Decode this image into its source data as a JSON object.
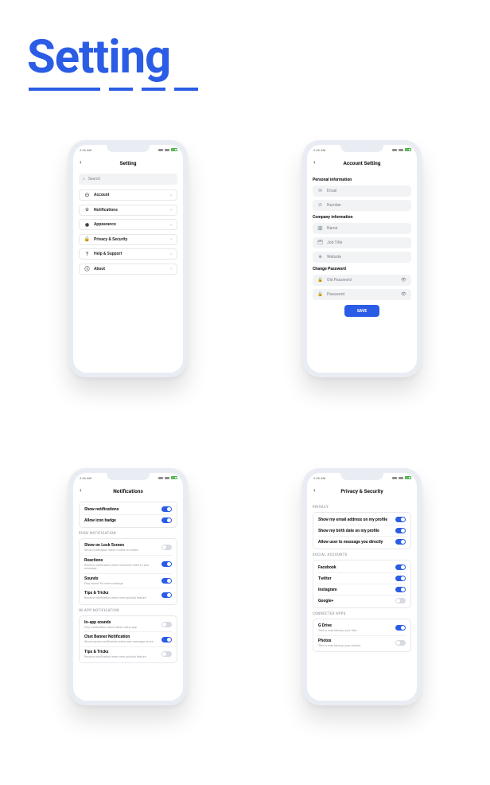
{
  "pageTitle": "Setting",
  "status": {
    "time": "2:36 AM"
  },
  "screen1": {
    "title": "Setting",
    "search": "Search",
    "items": [
      {
        "icon": "account-icon",
        "glyph": "⚇",
        "label": "Account"
      },
      {
        "icon": "notifications-icon",
        "glyph": "☆",
        "label": "Notifications"
      },
      {
        "icon": "appearance-icon",
        "glyph": "◉",
        "label": "Appearance"
      },
      {
        "icon": "privacy-icon",
        "glyph": "🔒",
        "label": "Privacy & Security"
      },
      {
        "icon": "help-icon",
        "glyph": "?",
        "label": "Help & Support"
      },
      {
        "icon": "about-icon",
        "glyph": "ⓘ",
        "label": "About"
      }
    ]
  },
  "screen2": {
    "title": "Account Setting",
    "sections": {
      "personal": {
        "label": "Personal information",
        "fields": [
          {
            "icon": "email-icon",
            "glyph": "✉",
            "placeholder": "Email"
          },
          {
            "icon": "phone-icon",
            "glyph": "✆",
            "placeholder": "Number"
          }
        ]
      },
      "company": {
        "label": "Company information",
        "fields": [
          {
            "icon": "company-icon",
            "glyph": "🏢",
            "placeholder": "Name"
          },
          {
            "icon": "job-icon",
            "glyph": "🗂",
            "placeholder": "Job Title"
          },
          {
            "icon": "website-icon",
            "glyph": "⊕",
            "placeholder": "Website"
          }
        ]
      },
      "password": {
        "label": "Change Password",
        "fields": [
          {
            "icon": "lock-icon",
            "glyph": "🔒",
            "placeholder": "Old Password",
            "eye": true
          },
          {
            "icon": "lock-icon",
            "glyph": "🔒",
            "placeholder": "Password",
            "eye": true
          }
        ]
      }
    },
    "save": "SAVE"
  },
  "screen3": {
    "title": "Notifications",
    "top": [
      {
        "title": "Show notifications",
        "on": true
      },
      {
        "title": "Allow icon badge",
        "on": true
      }
    ],
    "pushLabel": "PUSH NOTIFICATION",
    "push": [
      {
        "title": "Show on Lock Screen",
        "sub": "Show notification when mobile is locked",
        "on": false
      },
      {
        "title": "Reactions",
        "sub": "Receive notification when someone react to your message",
        "on": true
      },
      {
        "title": "Sounds",
        "sub": "Play sound for new message",
        "on": true
      },
      {
        "title": "Tips & Tricks",
        "sub": "Receive notification when new product feature",
        "on": true
      }
    ],
    "inappLabel": "IN-APP NOTIFICATION",
    "inapp": [
      {
        "title": "In-app sounds",
        "sub": "Play notification sound when using app",
        "on": false
      },
      {
        "title": "Chat Banner Notification",
        "sub": "Show banner notification when new message arrive",
        "on": true
      },
      {
        "title": "Tips & Tricks",
        "sub": "Receive notification when new product feature",
        "on": false
      }
    ]
  },
  "screen4": {
    "title": "Privacy & Security",
    "privacyLabel": "PRIVACY",
    "privacy": [
      {
        "title": "Show my email address on my profile",
        "on": true
      },
      {
        "title": "Show my birth date on my profile",
        "on": true
      },
      {
        "title": "Allow user to message you directly",
        "on": true
      }
    ],
    "socialLabel": "SOCIAL ACCOUNTS",
    "social": [
      {
        "title": "Facebook",
        "on": true
      },
      {
        "title": "Twitter",
        "on": true
      },
      {
        "title": "Instagram",
        "on": true
      },
      {
        "title": "Google+",
        "on": false
      }
    ],
    "appsLabel": "CONNECTED APPS",
    "apps": [
      {
        "title": "G Drive",
        "sub": "This is may backup your files",
        "on": true
      },
      {
        "title": "Photos",
        "sub": "This is may backup your photos",
        "on": false
      }
    ]
  }
}
